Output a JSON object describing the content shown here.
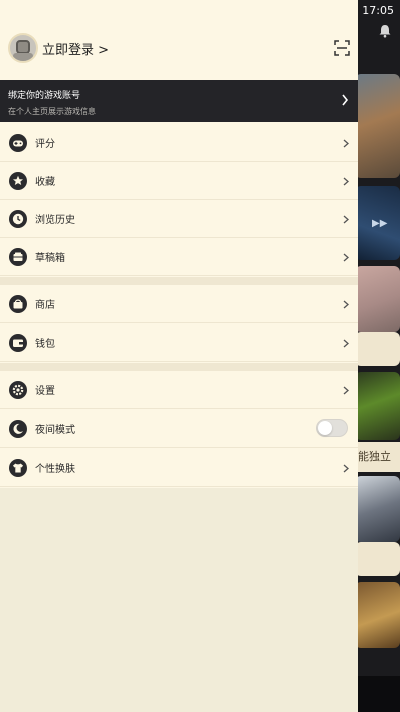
{
  "status_bar": {
    "time": "17:05"
  },
  "header": {
    "login_label": "立即登录 >"
  },
  "bind_banner": {
    "title": "绑定你的游戏账号",
    "subtitle": "在个人主页展示游戏信息"
  },
  "menu": {
    "group1": [
      {
        "label": "评分",
        "icon": "gamepad-icon"
      },
      {
        "label": "收藏",
        "icon": "star-icon"
      },
      {
        "label": "浏览历史",
        "icon": "clock-icon"
      },
      {
        "label": "草稿箱",
        "icon": "draft-icon"
      }
    ],
    "group2": [
      {
        "label": "商店",
        "icon": "shop-icon"
      },
      {
        "label": "钱包",
        "icon": "wallet-icon"
      }
    ],
    "group3": [
      {
        "label": "设置",
        "icon": "gear-icon"
      },
      {
        "label": "夜间模式",
        "icon": "moon-icon",
        "toggle": false
      },
      {
        "label": "个性换肤",
        "icon": "shirt-icon"
      }
    ]
  },
  "background": {
    "partial_caption": "能独立"
  },
  "colors": {
    "drawer_bg": "#fdf7e4",
    "banner_bg": "#242428",
    "icon_dark": "#2b2b2e"
  }
}
